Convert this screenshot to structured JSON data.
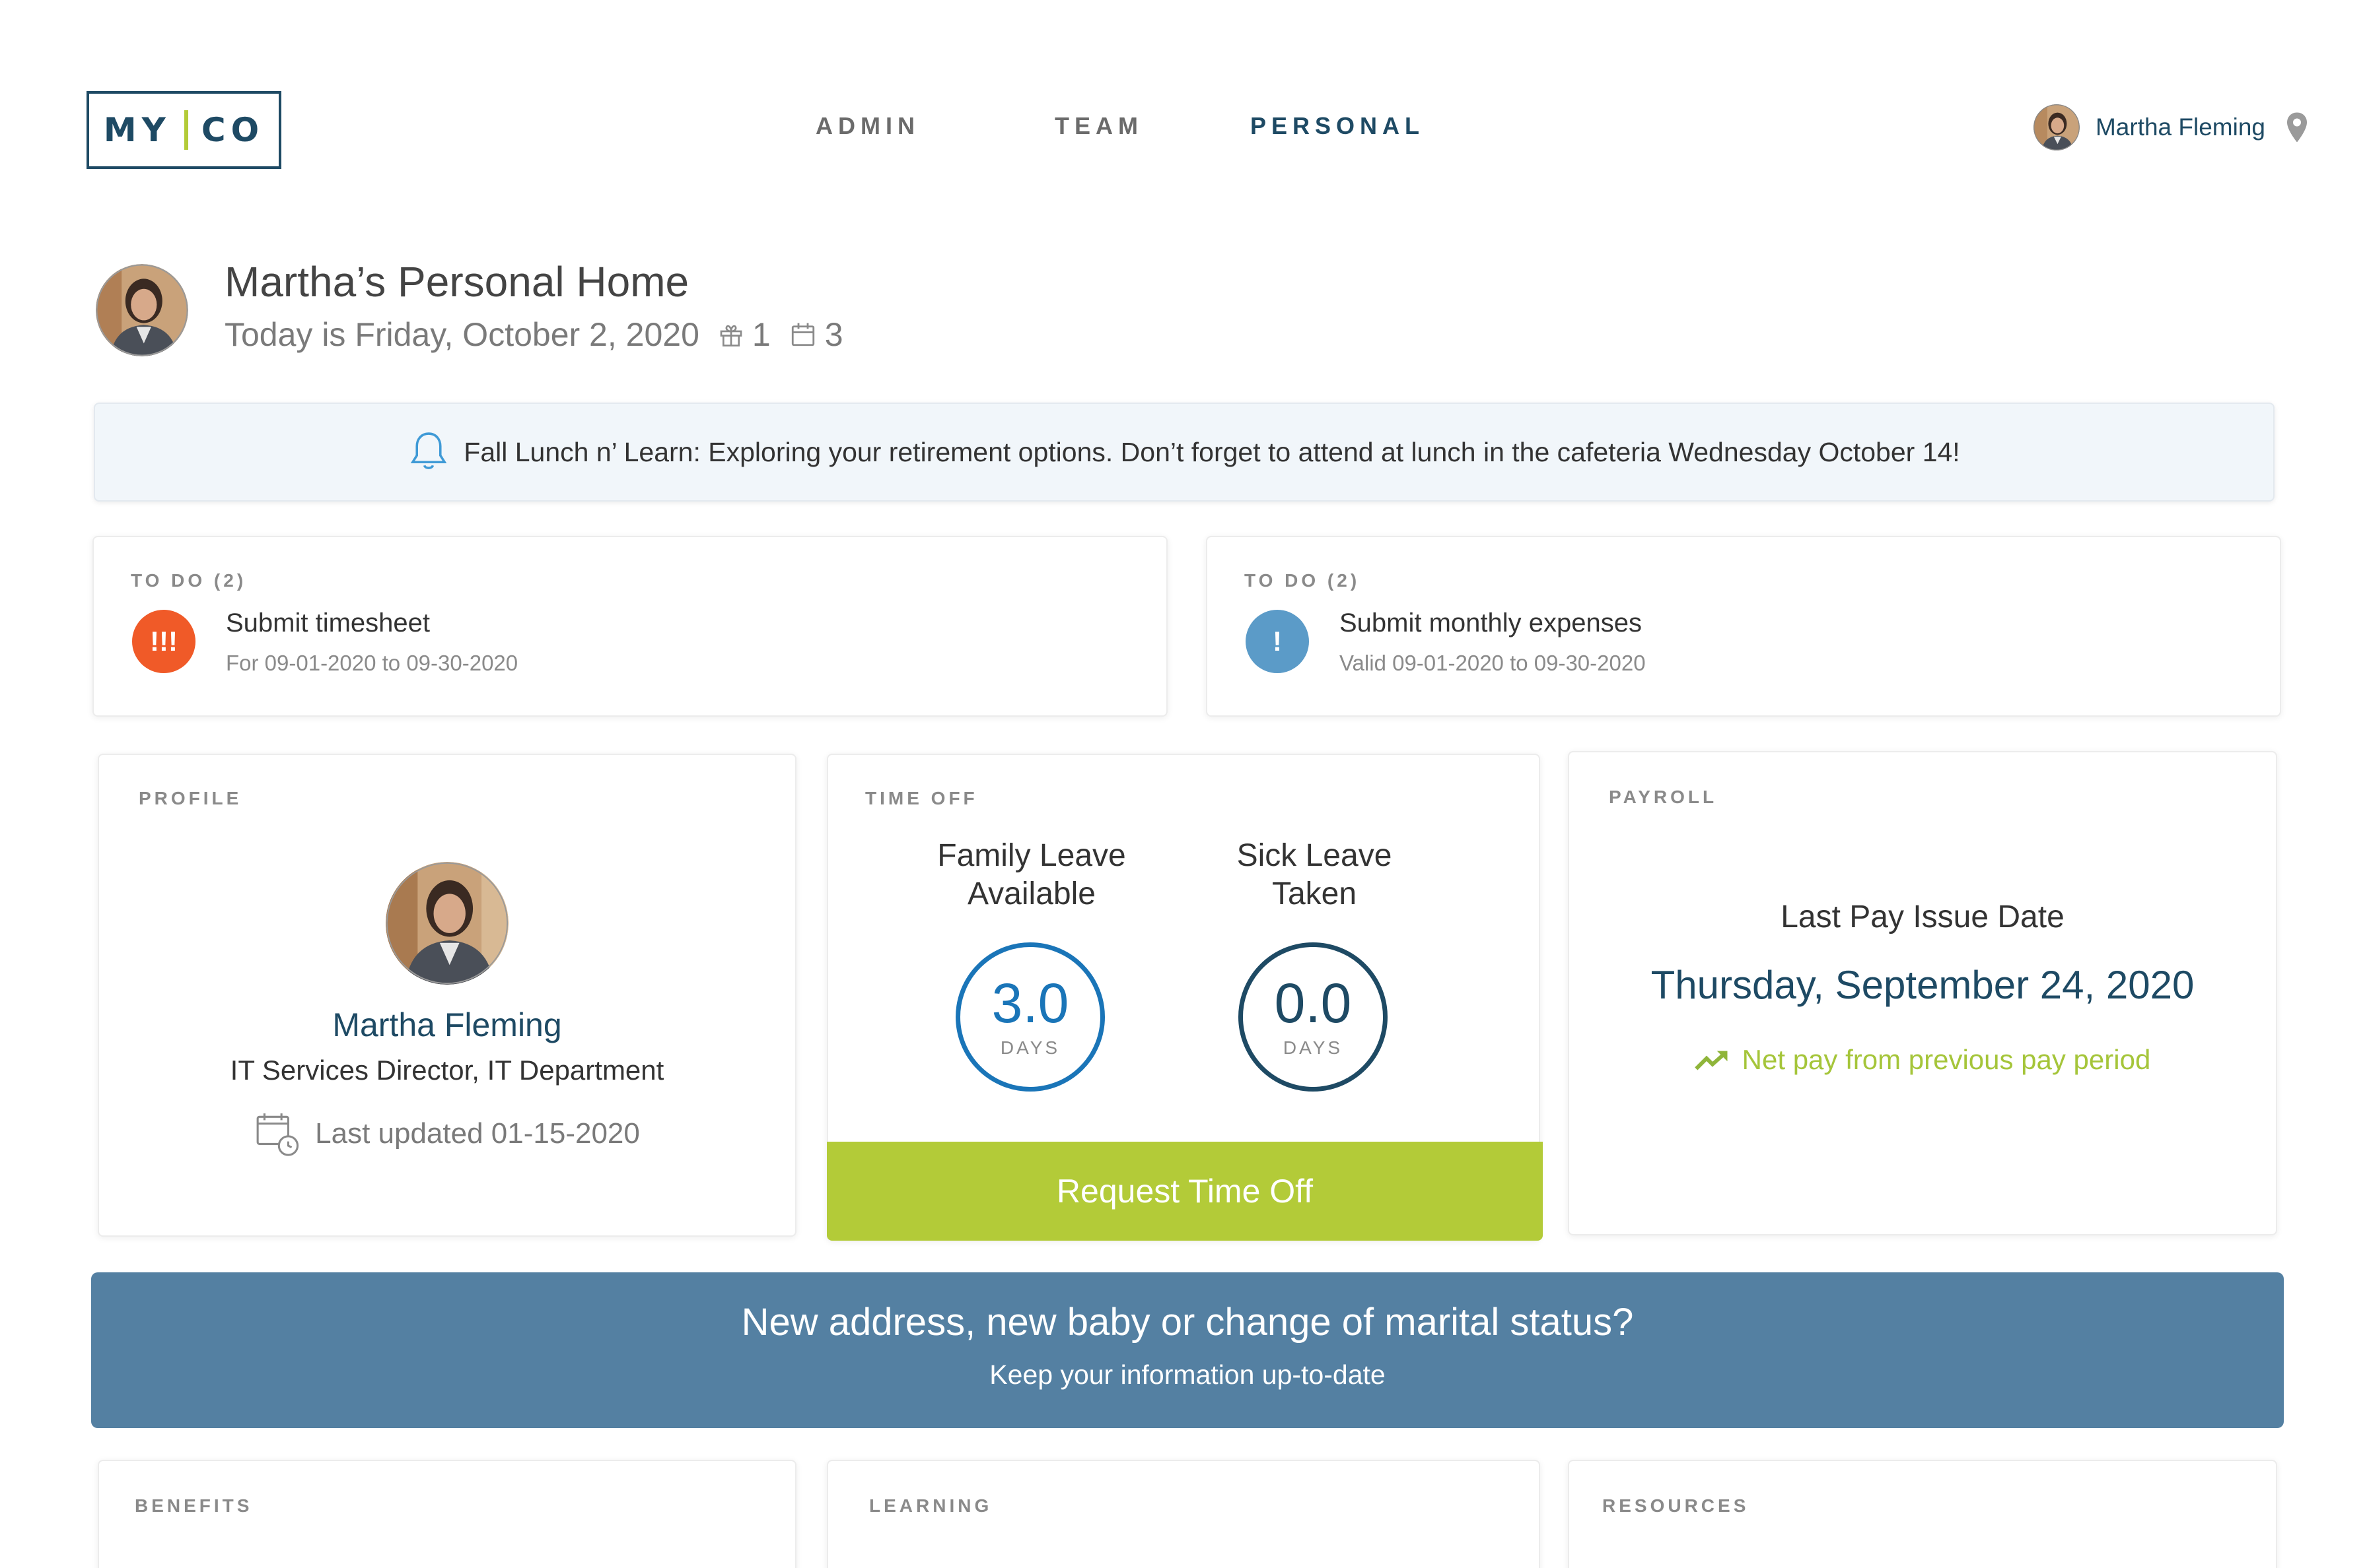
{
  "logo": {
    "left": "MY",
    "right": "CO"
  },
  "nav": {
    "admin": "ADMIN",
    "team": "TEAM",
    "personal": "PERSONAL"
  },
  "user": {
    "name": "Martha Fleming"
  },
  "hero": {
    "title": "Martha’s Personal Home",
    "date": "Today is Friday, October 2, 2020",
    "gift_count": "1",
    "calendar_count": "3"
  },
  "announcement": "Fall Lunch n’ Learn: Exploring your retirement options. Don’t forget to attend at lunch in the cafeteria Wednesday October 14!",
  "todos": [
    {
      "label": "TO DO (2)",
      "badge": "!!!",
      "title": "Submit timesheet",
      "sub": "For 09-01-2020 to 09-30-2020",
      "color": "#f05a28"
    },
    {
      "label": "TO DO (2)",
      "badge": "!",
      "title": "Submit monthly expenses",
      "sub": "Valid 09-01-2020 to 09-30-2020",
      "color": "#5b9bc8"
    }
  ],
  "profile": {
    "label": "PROFILE",
    "name": "Martha Fleming",
    "role": "IT Services Director, IT Department",
    "updated": "Last updated 01-15-2020"
  },
  "time_off": {
    "label": "TIME OFF",
    "family_title_1": "Family Leave",
    "family_title_2": "Available",
    "family_value": "3.0",
    "sick_title_1": "Sick Leave",
    "sick_title_2": "Taken",
    "sick_value": "0.0",
    "unit": "DAYS",
    "button": "Request Time Off"
  },
  "payroll": {
    "label": "PAYROLL",
    "issue_label": "Last Pay Issue Date",
    "issue_date": "Thursday, September 24, 2020",
    "net": "Net pay from previous pay period"
  },
  "cta": {
    "title": "New address, new baby or change of marital status?",
    "subtitle": "Keep your information up-to-date"
  },
  "bottom": {
    "benefits": "BENEFITS",
    "learning": "LEARNING",
    "resources": "RESOURCES"
  },
  "colors": {
    "navy": "#1e4a64",
    "green": "#b3cb38",
    "blue": "#1a75b8",
    "cta": "#5480a2"
  }
}
